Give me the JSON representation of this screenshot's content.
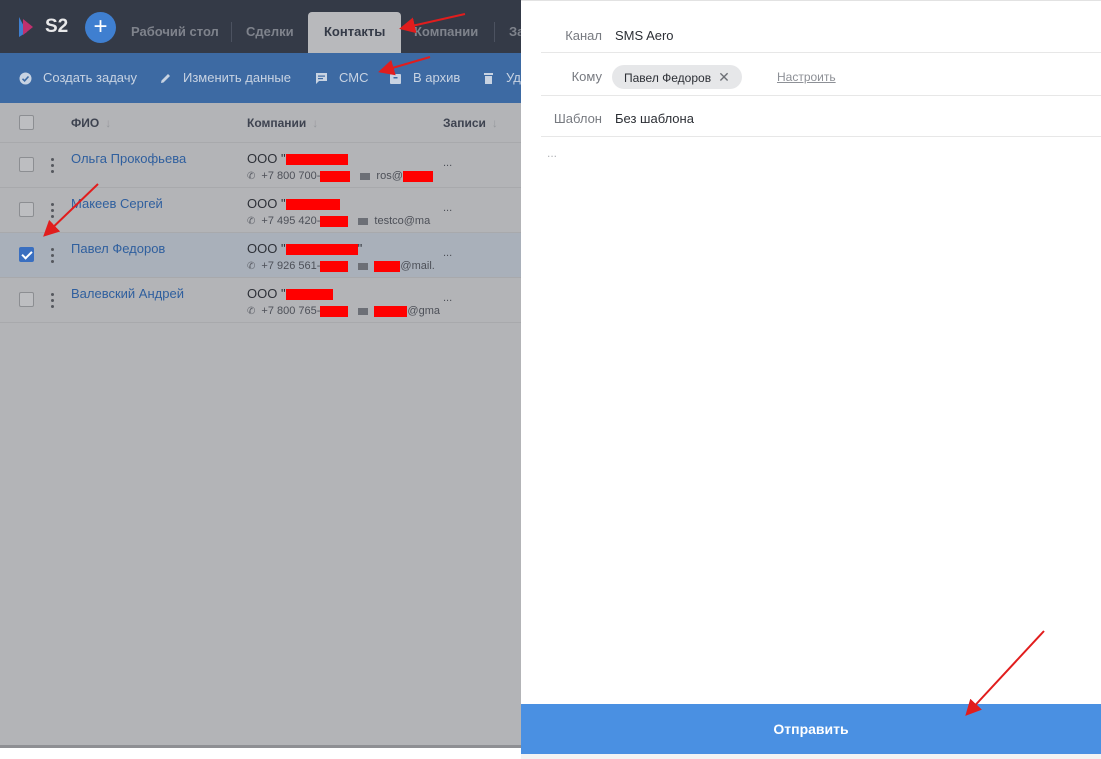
{
  "app": {
    "logo_text": "S2"
  },
  "nav": {
    "plus": "+",
    "tabs": [
      {
        "label": "Рабочий стол"
      },
      {
        "label": "Сделки"
      },
      {
        "label": "Контакты"
      },
      {
        "label": "Компании"
      },
      {
        "label": "За"
      }
    ]
  },
  "actions": {
    "create_task": "Создать задачу",
    "edit_data": "Изменить данные",
    "sms": "СМС",
    "archive": "В архив",
    "delete": "Уд"
  },
  "table": {
    "headers": {
      "name": "ФИО",
      "company": "Компании",
      "records": "Записи"
    },
    "sort_arrow": "↓",
    "rows": [
      {
        "name": "Ольга Прокофьева",
        "company_prefix": "ООО \"",
        "phone": "+7 800 700-",
        "email": "ros@",
        "records": "...",
        "checked": false
      },
      {
        "name": "Макеев Сергей",
        "company_prefix": "ООО \"",
        "phone": "+7 495 420-",
        "email": "testco@ma",
        "records": "...",
        "checked": false
      },
      {
        "name": "Павел Федоров",
        "company_prefix": "ООО \"",
        "company_suffix": "\"",
        "phone": "+7 926 561-",
        "email": "@mail.",
        "records": "...",
        "checked": true
      },
      {
        "name": "Валевский Андрей",
        "company_prefix": "ООО \"",
        "phone": "+7 800 765-",
        "email": "@gma",
        "records": "...",
        "checked": false
      }
    ]
  },
  "panel": {
    "channel_label": "Канал",
    "channel_value": "SMS Aero",
    "to_label": "Кому",
    "recipient": "Павел Федоров",
    "remove_symbol": "✕",
    "configure": "Настроить",
    "template_label": "Шаблон",
    "template_value": "Без шаблона",
    "message_placeholder": "...",
    "send": "Отправить"
  },
  "colors": {
    "topbar": "#343a47",
    "actionbar": "#3d6aa3",
    "send_button": "#4a90e2",
    "annotation_arrow": "#e11d1d",
    "redaction": "#ff0000"
  }
}
